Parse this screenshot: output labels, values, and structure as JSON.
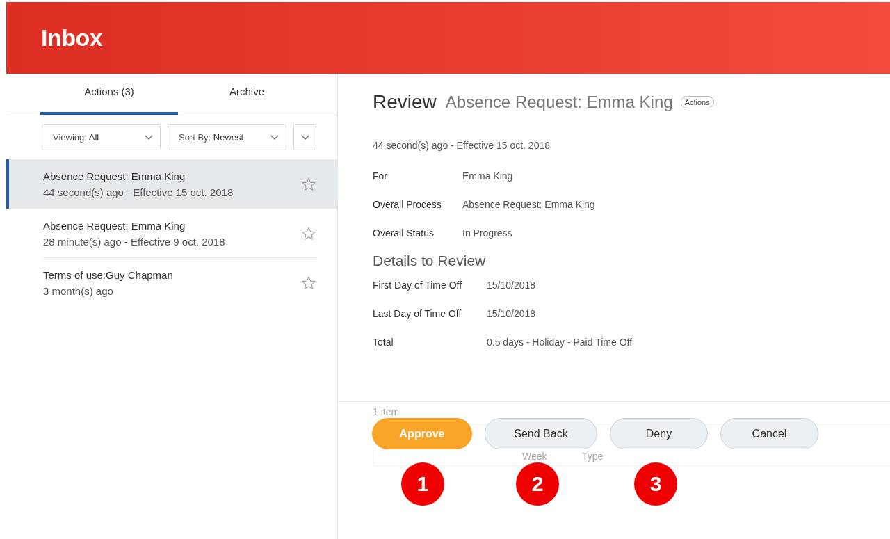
{
  "header": {
    "title": "Inbox"
  },
  "tabs": [
    {
      "label": "Actions (3)",
      "selected": true
    },
    {
      "label": "Archive",
      "selected": false
    }
  ],
  "filters": [
    {
      "label": "Viewing:",
      "value": "All"
    },
    {
      "label": "Sort By:",
      "value": "Newest"
    }
  ],
  "inbox_items": [
    {
      "title": "Absence Request: Emma King",
      "subtitle": "44 second(s) ago - Effective 15 oct. 2018",
      "selected": true
    },
    {
      "title": "Absence Request: Emma King",
      "subtitle": "28 minute(s) ago - Effective 9 oct. 2018",
      "selected": false
    },
    {
      "title": "Terms of use:Guy Chapman",
      "subtitle": "3 month(s) ago",
      "selected": false
    }
  ],
  "detail": {
    "title": "Review",
    "subtitle": "Absence Request: Emma King",
    "badge": "Actions",
    "meta": "44 second(s) ago -  Effective 15 oct. 2018",
    "fields": [
      {
        "label": "For",
        "value": "Emma King"
      },
      {
        "label": "Overall Process",
        "value": "Absence Request: Emma King"
      },
      {
        "label": "Overall Status",
        "value": "In Progress"
      }
    ],
    "section_title": "Details to Review",
    "details": [
      {
        "label": "First Day of Time Off",
        "value": "15/10/2018"
      },
      {
        "label": "Last Day of Time Off",
        "value": "15/10/2018"
      },
      {
        "label": "Total",
        "value": "0.5 days - Holiday - Paid Time Off"
      }
    ]
  },
  "background_table": {
    "count": "1 item",
    "columns": [
      "Week",
      "Type"
    ]
  },
  "buttons": [
    {
      "label": "Approve",
      "kind": "primary"
    },
    {
      "label": "Send Back",
      "kind": "secondary"
    },
    {
      "label": "Deny",
      "kind": "secondary"
    },
    {
      "label": "Cancel",
      "kind": "secondary"
    }
  ],
  "callouts": [
    "1",
    "2",
    "3"
  ]
}
